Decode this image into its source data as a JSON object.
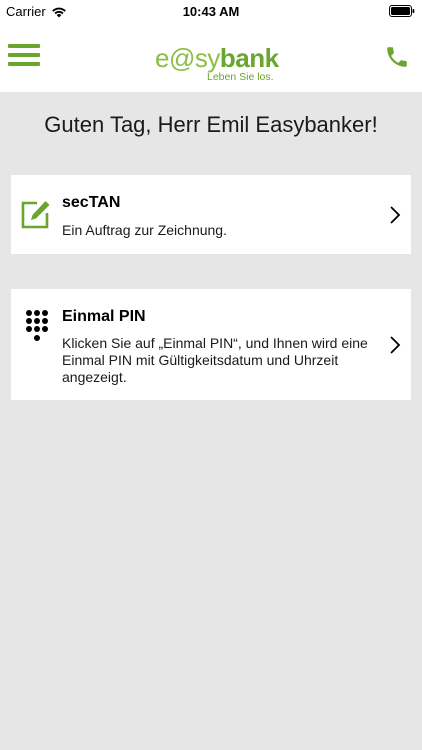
{
  "status_bar": {
    "carrier": "Carrier",
    "time": "10:43 AM"
  },
  "header": {
    "logo_part1": "e@sy",
    "logo_part2": "bank",
    "logo_tagline": "Leben Sie los."
  },
  "greeting": "Guten Tag, Herr Emil Easybanker!",
  "options": [
    {
      "title": "secTAN",
      "description": "Ein Auftrag zur Zeichnung.",
      "icon": "edit-icon"
    },
    {
      "title": "Einmal PIN",
      "description": "Klicken Sie auf „Einmal PIN“, und Ihnen wird eine Einmal PIN mit Gültigkeitsdatum und Uhrzeit angezeigt.",
      "icon": "keypad-icon"
    }
  ],
  "colors": {
    "brand_green": "#69a52f",
    "brand_light_green": "#8bbf43",
    "background": "#e6e6e6"
  }
}
